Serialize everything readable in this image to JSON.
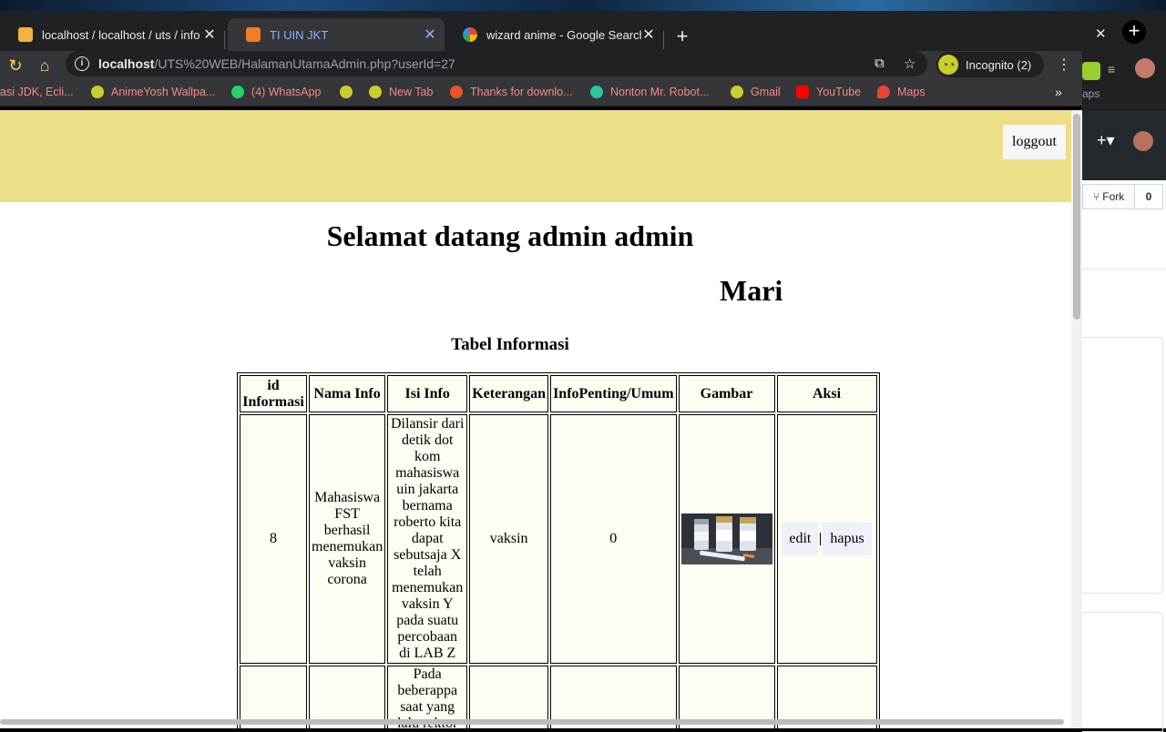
{
  "browser": {
    "tabs": [
      {
        "title": "localhost / localhost / uts / info",
        "active": false
      },
      {
        "title": "TI UIN JKT",
        "active": true
      },
      {
        "title": "wizard anime - Google Search",
        "active": false
      }
    ],
    "url_host": "localhost",
    "url_path": "/UTS%20WEB/HalamanUtamaAdmin.php?userId=27",
    "incognito_label": "Incognito (2)",
    "bookmarks": [
      {
        "label": "asi JDK, Ecli...",
        "icon_color": ""
      },
      {
        "label": "AnimeYosh Wallpa...",
        "icon_color": "#c8cf2c"
      },
      {
        "label": "(4) WhatsApp",
        "icon_color": "#25d366"
      },
      {
        "label": "",
        "icon_color": "#c8cf2c"
      },
      {
        "label": "New Tab",
        "icon_color": "#c8cf2c"
      },
      {
        "label": "Thanks for downlo...",
        "icon_color": "#e95420"
      },
      {
        "label": "Nonton Mr. Robot...",
        "icon_color": "#2bc4a0"
      },
      {
        "label": "Gmail",
        "icon_color": "#c8cf2c"
      },
      {
        "label": "YouTube",
        "icon_color": "#ff0000"
      },
      {
        "label": "Maps",
        "icon_color": "#ea4335"
      }
    ],
    "bookmark_overflow": "»",
    "background_window": {
      "fork_label": "Fork",
      "fork_count": "0",
      "maps_fragment": "aps"
    }
  },
  "page": {
    "logout_label": "loggout",
    "welcome": "Selamat datang admin admin",
    "mari": "Mari",
    "table_title": "Tabel Informasi",
    "colors": {
      "header_bg": "#ecdf87",
      "cell_bg": "#fdfdf2"
    },
    "table": {
      "headers": [
        "id Informasi",
        "Nama Info",
        "Isi Info",
        "Keterangan",
        "InfoPenting/Umum",
        "Gambar",
        "Aksi"
      ],
      "rows": [
        {
          "id": "8",
          "nama": "Mahasiswa FST berhasil menemukan vaksin corona",
          "isi": "Dilansir dari detik dot kom mahasiswa uin jakarta bernama roberto kita dapat sebutsaja X telah menemukan vaksin Y pada suatu percobaan di LAB Z",
          "keterangan": "vaksin",
          "penting": "0",
          "gambar": "vaccine-vials-image",
          "edit": "edit",
          "hapus": "hapus"
        },
        {
          "id": "",
          "nama": "",
          "isi": "Pada beberappa saat yang lalu rektor",
          "keterangan": "",
          "penting": "",
          "gambar": "",
          "edit": "",
          "hapus": ""
        }
      ]
    }
  }
}
